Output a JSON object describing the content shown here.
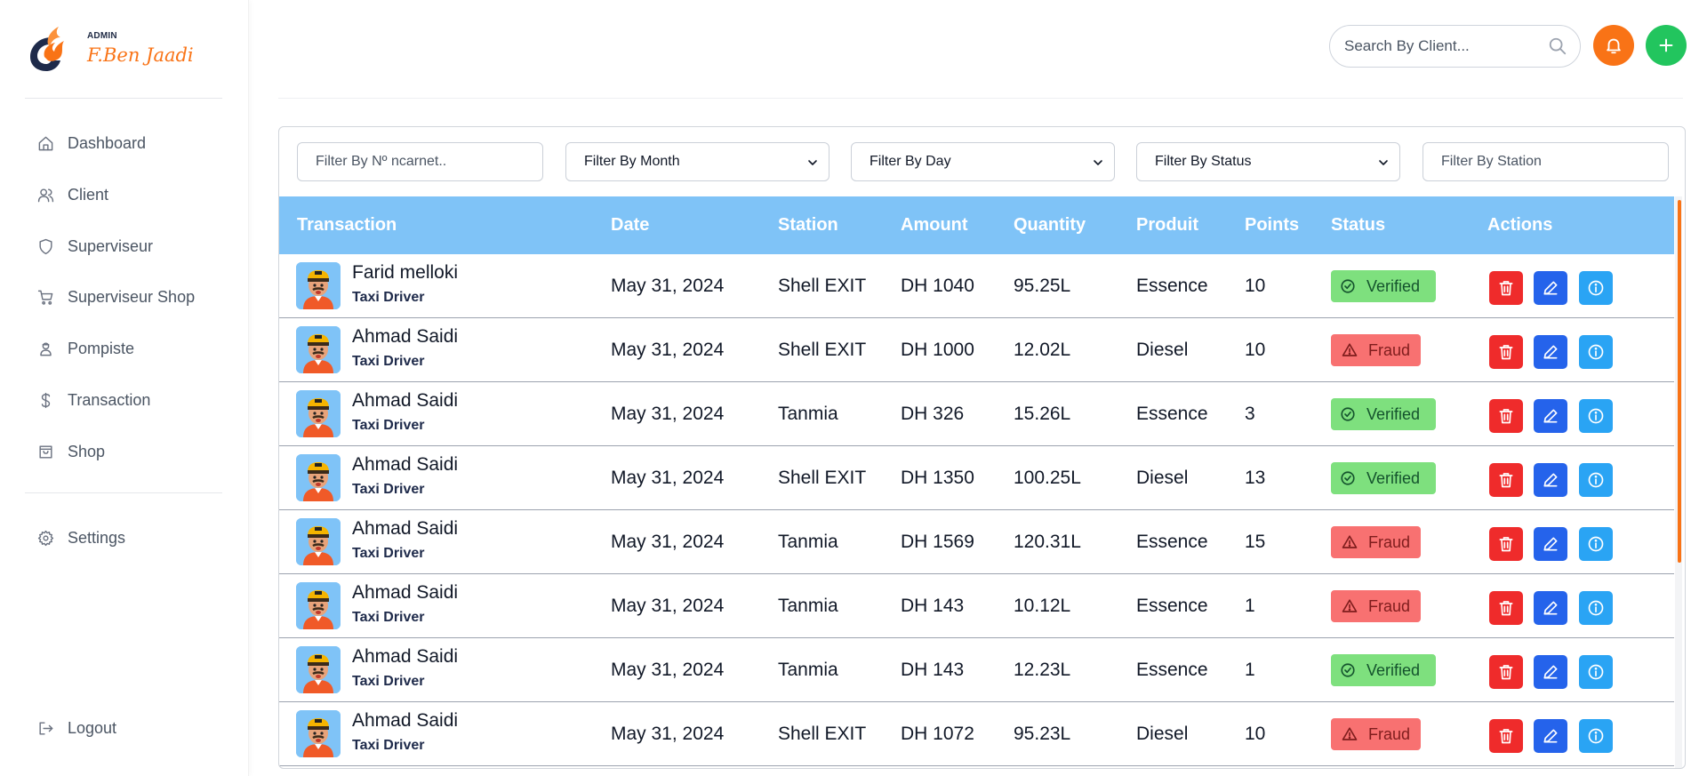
{
  "brand": {
    "role": "ADMIN",
    "name": "F.Ben Jaadi",
    "logo_icon": "flame-logo-icon"
  },
  "nav": [
    {
      "label": "Dashboard",
      "icon": "home-icon"
    },
    {
      "label": "Client",
      "icon": "users-icon"
    },
    {
      "label": "Superviseur",
      "icon": "shield-icon"
    },
    {
      "label": "Superviseur Shop",
      "icon": "cart-icon"
    },
    {
      "label": "Pompiste",
      "icon": "person-icon"
    },
    {
      "label": "Transaction",
      "icon": "dollar-icon"
    },
    {
      "label": "Shop",
      "icon": "bag-icon"
    }
  ],
  "settings": {
    "label": "Settings",
    "icon": "gear-icon"
  },
  "logout": {
    "label": "Logout",
    "icon": "logout-icon"
  },
  "header": {
    "search_placeholder": "Search By Client...",
    "colors": {
      "bell": "#f97316",
      "add": "#22c55e"
    }
  },
  "filters": {
    "carnet_placeholder": "Filter By Nº ncarnet..",
    "month": "Filter By Month",
    "day": "Filter By Day",
    "status": "Filter By Status",
    "station_placeholder": "Filter By Station"
  },
  "table": {
    "columns": [
      "Transaction",
      "Date",
      "Station",
      "Amount",
      "Quantity",
      "Produit",
      "Points",
      "Status",
      "Actions"
    ],
    "header_color": "#7fc3f7",
    "rows": [
      {
        "name": "Farid melloki",
        "role": "Taxi Driver",
        "date": "May 31, 2024",
        "station": "Shell EXIT",
        "amount": "DH 1040",
        "quantity": "95.25L",
        "produit": "Essence",
        "points": "10",
        "status": "Verified"
      },
      {
        "name": "Ahmad Saidi",
        "role": "Taxi Driver",
        "date": "May 31, 2024",
        "station": "Shell EXIT",
        "amount": "DH 1000",
        "quantity": "12.02L",
        "produit": "Diesel",
        "points": "10",
        "status": "Fraud"
      },
      {
        "name": "Ahmad Saidi",
        "role": "Taxi Driver",
        "date": "May 31, 2024",
        "station": "Tanmia",
        "amount": "DH 326",
        "quantity": "15.26L",
        "produit": "Essence",
        "points": "3",
        "status": "Verified"
      },
      {
        "name": "Ahmad Saidi",
        "role": "Taxi Driver",
        "date": "May 31, 2024",
        "station": "Shell EXIT",
        "amount": "DH 1350",
        "quantity": "100.25L",
        "produit": "Diesel",
        "points": "13",
        "status": "Verified"
      },
      {
        "name": "Ahmad Saidi",
        "role": "Taxi Driver",
        "date": "May 31, 2024",
        "station": "Tanmia",
        "amount": "DH 1569",
        "quantity": "120.31L",
        "produit": "Essence",
        "points": "15",
        "status": "Fraud"
      },
      {
        "name": "Ahmad Saidi",
        "role": "Taxi Driver",
        "date": "May 31, 2024",
        "station": "Tanmia",
        "amount": "DH 143",
        "quantity": "10.12L",
        "produit": "Essence",
        "points": "1",
        "status": "Fraud"
      },
      {
        "name": "Ahmad Saidi",
        "role": "Taxi Driver",
        "date": "May 31, 2024",
        "station": "Tanmia",
        "amount": "DH 143",
        "quantity": "12.23L",
        "produit": "Essence",
        "points": "1",
        "status": "Verified"
      },
      {
        "name": "Ahmad Saidi",
        "role": "Taxi Driver",
        "date": "May 31, 2024",
        "station": "Shell EXIT",
        "amount": "DH 1072",
        "quantity": "95.23L",
        "produit": "Diesel",
        "points": "10",
        "status": "Fraud"
      }
    ]
  }
}
